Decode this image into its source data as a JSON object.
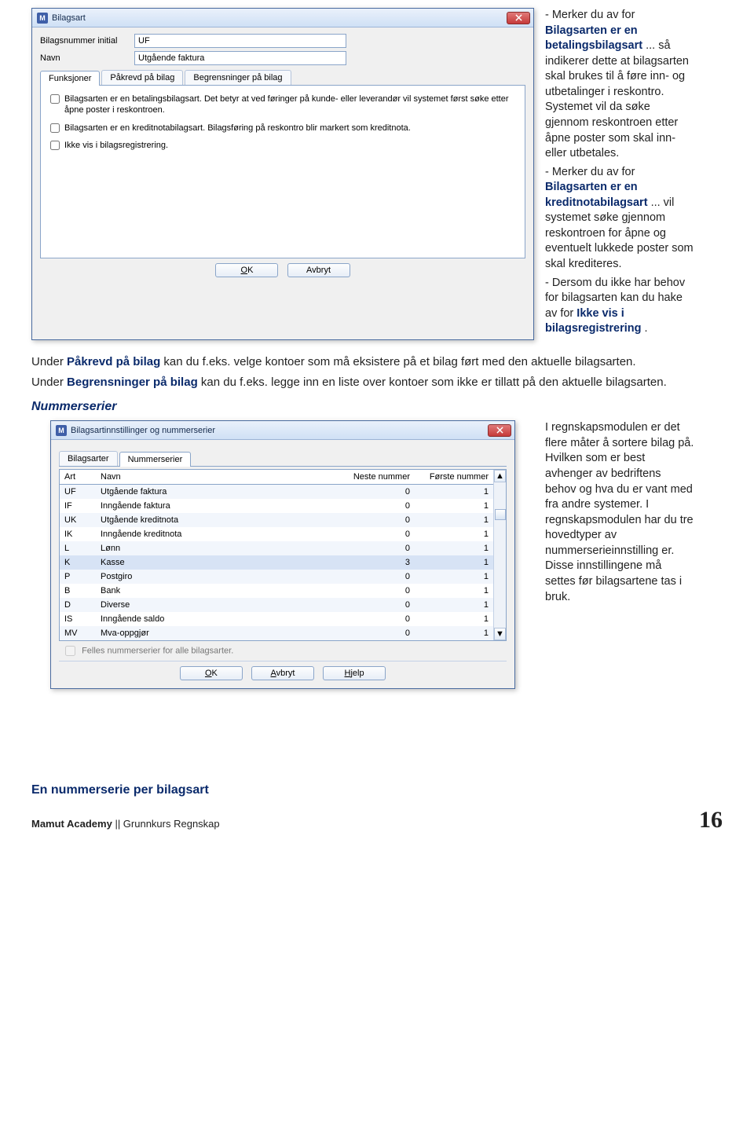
{
  "dialog1": {
    "title": "Bilagsart",
    "label_initial": "Bilagsnummer initial",
    "value_initial": "UF",
    "label_name": "Navn",
    "value_name": "Utgående faktura",
    "tabs": {
      "funksjoner": "Funksjoner",
      "pakrevd": "Påkrevd på bilag",
      "begrensninger": "Begrensninger på bilag"
    },
    "check1": "Bilagsarten er en betalingsbilagsart. Det betyr at ved føringer på kunde- eller leverandør vil systemet først søke etter åpne poster i reskontroen.",
    "check2": "Bilagsarten er en kreditnotabilagsart. Bilagsføring på reskontro blir markert som kreditnota.",
    "check3": "Ikke vis i bilagsregistrering.",
    "btn_ok": "OK",
    "btn_cancel": "Avbryt"
  },
  "side1": {
    "p1a": "- Merker du av for ",
    "p1b": "Bilagsarten er en betalingsbilagsart",
    "p1c": "... så indikerer dette at bilagsarten skal brukes til å føre inn- og utbetalinger i reskontro. Systemet vil da søke gjennom reskontroen etter åpne poster som skal inn- eller utbetales.",
    "p2a": "- Merker du av for ",
    "p2b": "Bilagsarten er en kreditnotabilagsart",
    "p2c": "... vil systemet søke gjennom reskontroen for åpne og eventuelt lukkede poster som skal krediteres.",
    "p3a": "- Dersom du ikke har behov for bilagsarten kan du hake av for ",
    "p3b": "Ikke vis i bilagsregistrering",
    "p3c": "."
  },
  "mid": {
    "p1a": "Under ",
    "p1b": "Påkrevd på bilag",
    "p1c": " kan du f.eks. velge kontoer som må eksistere på et bilag ført med den aktuelle bilagsarten.",
    "p2a": "Under ",
    "p2b": "Begrensninger på bilag",
    "p2c": " kan du f.eks. legge inn en liste over kontoer som ikke er tillatt på den aktuelle bilagsarten.",
    "heading_nummerserier": "Nummerserier"
  },
  "dialog2": {
    "title": "Bilagsartinnstillinger og nummerserier",
    "tab_bilagsarter": "Bilagsarter",
    "tab_nummerserier": "Nummerserier",
    "col_art": "Art",
    "col_navn": "Navn",
    "col_neste": "Neste nummer",
    "col_forste": "Første nummer",
    "rows": [
      {
        "art": "UF",
        "navn": "Utgående faktura",
        "neste": "0",
        "forste": "1"
      },
      {
        "art": "IF",
        "navn": "Inngående faktura",
        "neste": "0",
        "forste": "1"
      },
      {
        "art": "UK",
        "navn": "Utgående kreditnota",
        "neste": "0",
        "forste": "1"
      },
      {
        "art": "IK",
        "navn": "Inngående kreditnota",
        "neste": "0",
        "forste": "1"
      },
      {
        "art": "L",
        "navn": "Lønn",
        "neste": "0",
        "forste": "1"
      },
      {
        "art": "K",
        "navn": "Kasse",
        "neste": "3",
        "forste": "1"
      },
      {
        "art": "P",
        "navn": "Postgiro",
        "neste": "0",
        "forste": "1"
      },
      {
        "art": "B",
        "navn": "Bank",
        "neste": "0",
        "forste": "1"
      },
      {
        "art": "D",
        "navn": "Diverse",
        "neste": "0",
        "forste": "1"
      },
      {
        "art": "IS",
        "navn": "Inngående saldo",
        "neste": "0",
        "forste": "1"
      },
      {
        "art": "MV",
        "navn": "Mva-oppgjør",
        "neste": "0",
        "forste": "1"
      }
    ],
    "felles": "Felles nummerserier for alle bilagsarter.",
    "btn_ok": "OK",
    "btn_cancel": "Avbryt",
    "btn_help": "Hjelp"
  },
  "side2": {
    "text": "I regnskapsmodulen er det flere måter å sortere bilag på. Hvilken som er best avhenger av bedriftens behov og hva du er vant med fra andre systemer. I regnskapsmodulen har du tre hovedtyper av nummerserieinnstilling er. Disse innstillingene må settes før bilagsartene tas i bruk."
  },
  "sub_heading": "En nummerserie per bilagsart",
  "footer": {
    "brand": "Mamut Academy",
    "course": " || Grunnkurs Regnskap",
    "page": "16"
  }
}
